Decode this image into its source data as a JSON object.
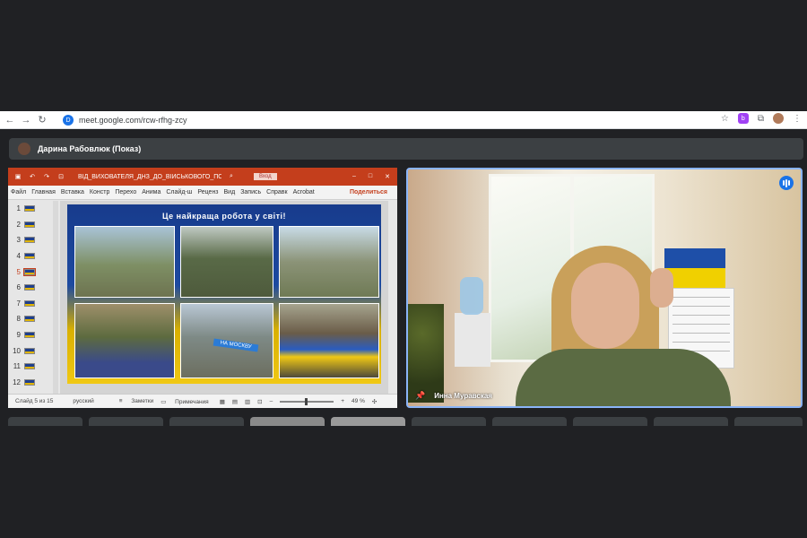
{
  "browser": {
    "url": "meet.google.com/rcw-rfhg-zcy",
    "site_icon": "D",
    "ext_icon": "b",
    "icons": [
      "back-icon",
      "forward-icon",
      "reload-icon",
      "star-icon",
      "extensions-icon",
      "menu-icon"
    ]
  },
  "meet": {
    "presenter_label": "Дарина Рабовлюк (Показ)",
    "participant_name": "Инна Муравская"
  },
  "ppt": {
    "filename": "ВІД_ВИХОВАТЕЛЯ_ДНЗ_ДО_ВІЙСЬКОВОГО_ПСИ...",
    "login_label": "Вход",
    "tabs": [
      "Файл",
      "Главная",
      "Вставка",
      "Констр",
      "Перехо",
      "Анима",
      "Слайд-ш",
      "Реценз",
      "Вид",
      "Запись",
      "Справк",
      "Acrobat"
    ],
    "share_label": "Поделиться",
    "slide_numbers": [
      "1",
      "2",
      "3",
      "4",
      "5",
      "6",
      "7",
      "8",
      "9",
      "10",
      "11",
      "12"
    ],
    "active_slide": "5",
    "slide_title": "Це найкраща робота у світі!",
    "sign_text": "НА МОСКВУ",
    "status": {
      "slide": "Слайд 5 из 15",
      "lang": "русский",
      "notes": "Заметки",
      "comments": "Примечания",
      "zoom": "49 %"
    }
  },
  "colors": {
    "ppt_red": "#c43e1c",
    "meet_bg": "#202124",
    "active_border": "#8ab4f8"
  }
}
